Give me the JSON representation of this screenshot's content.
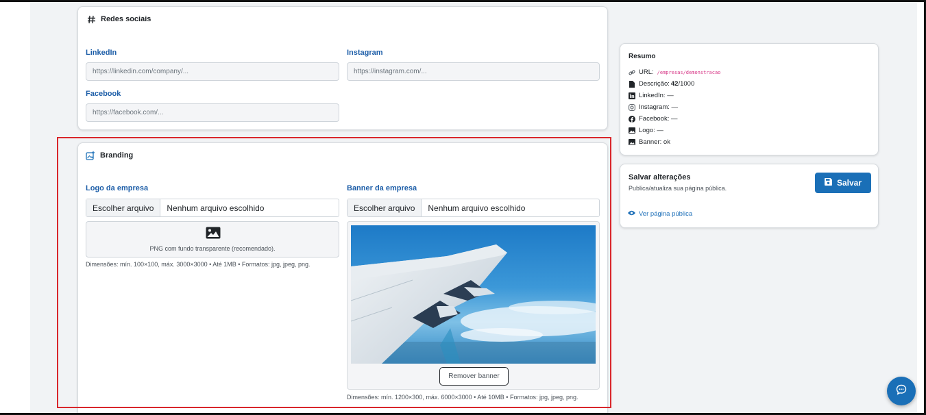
{
  "social": {
    "title": "Redes sociais",
    "linkedin": {
      "label": "LinkedIn",
      "placeholder": "https://linkedin.com/company/..."
    },
    "instagram": {
      "label": "Instagram",
      "placeholder": "https://instagram.com/..."
    },
    "facebook": {
      "label": "Facebook",
      "placeholder": "https://facebook.com/..."
    }
  },
  "branding": {
    "title": "Branding",
    "logo": {
      "label": "Logo da empresa",
      "choose_button": "Escolher arquivo",
      "file_status": "Nenhum arquivo escolhido",
      "placeholder_text": "PNG com fundo transparente (recomendado).",
      "hint": "Dimensões: mín. 100×100, máx. 3000×3000 • Até 1MB • Formatos: jpg, jpeg, png."
    },
    "banner": {
      "label": "Banner da empresa",
      "choose_button": "Escolher arquivo",
      "file_status": "Nenhum arquivo escolhido",
      "remove_button": "Remover banner",
      "hint": "Dimensões: mín. 1200×300, máx. 6000×3000 • Até 10MB • Formatos: jpg, jpeg, png."
    }
  },
  "summary": {
    "title": "Resumo",
    "url_label": "URL:",
    "url_value": "/empresas/demonstracao",
    "desc_label": "Descrição:",
    "desc_count": "42",
    "desc_max": "/1000",
    "linkedin": "LinkedIn: —",
    "instagram": "Instagram: —",
    "facebook": "Facebook: —",
    "logo": "Logo: —",
    "banner": "Banner: ok"
  },
  "save": {
    "title": "Salvar alterações",
    "subtitle": "Publica/atualiza sua página pública.",
    "button": "Salvar",
    "view_link": "Ver página pública"
  },
  "colors": {
    "accent": "#1a6fb7",
    "label_blue": "#1d5ea8",
    "highlight_red": "#d9262b",
    "background": "#f1f3f5"
  }
}
